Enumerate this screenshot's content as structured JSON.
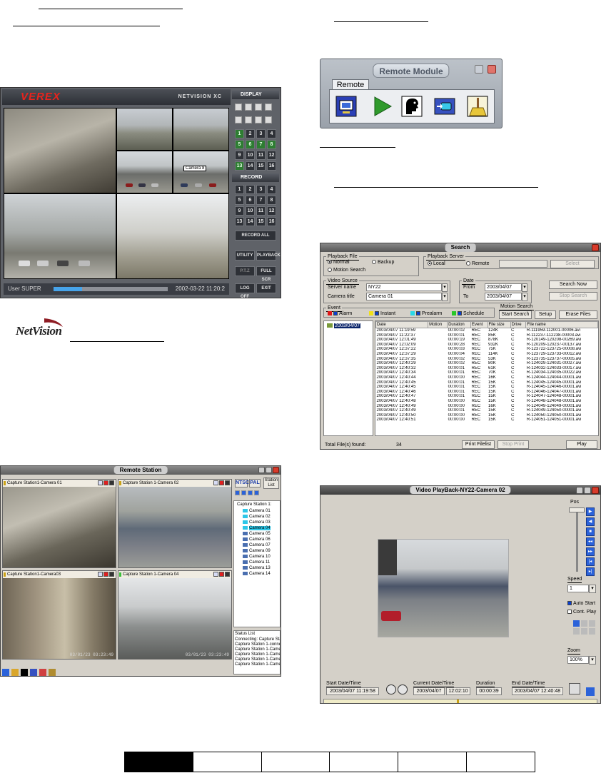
{
  "netvision_screen": {
    "brand": "VEREX",
    "product": "NETVISION XC",
    "camera_label": "Camera 8",
    "display_label": "DISPLAY",
    "record_label": "RECORD",
    "display_numbers": [
      "1",
      "2",
      "3",
      "4",
      "5",
      "6",
      "7",
      "8",
      "9",
      "10",
      "11",
      "12",
      "13",
      "14",
      "15",
      "16"
    ],
    "record_numbers": [
      "1",
      "2",
      "3",
      "4",
      "5",
      "6",
      "7",
      "8",
      "9",
      "10",
      "11",
      "12",
      "13",
      "14",
      "15",
      "16"
    ],
    "record_all": "RECORD ALL",
    "buttons": [
      "UTILITY",
      "PLAYBACK",
      "P.T.Z",
      "FULL SCR",
      "LOG OFF",
      "EXIT"
    ],
    "user": "User SUPER",
    "datetime": "2002-03-22 11:20:2",
    "progress_fraction": 0.25,
    "colors": {
      "brand_red": "#e8231d",
      "progress": "#47a4ea",
      "active_green": "#2e7d32"
    }
  },
  "netvision_logo": {
    "text": "NetVision"
  },
  "remote_module": {
    "title": "Remote Module",
    "tab": "Remote",
    "icons": [
      "monitor-icon",
      "play-icon",
      "face-profile-icon",
      "camera-transfer-icon",
      "broom-icon"
    ]
  },
  "search_window": {
    "title": "Search",
    "playback_file": {
      "label": "Playback File",
      "options": [
        "Normal",
        "Backup",
        "Motion Search"
      ]
    },
    "playback_server": {
      "label": "Playback Server",
      "options": [
        "Local",
        "Remote"
      ],
      "select_btn": "Select"
    },
    "video_source": {
      "label": "Video Source",
      "server_name_label": "Server name",
      "server_name": "NY22",
      "camera_title_label": "Camera title",
      "camera_title": "Camera 01"
    },
    "date": {
      "label": "Date",
      "from_label": "From",
      "from": "2003/04/07",
      "to_label": "To",
      "to": "2003/04/07"
    },
    "search_now": "Search Now",
    "stop_search": "Stop Search",
    "event": {
      "label": "Event",
      "items": [
        "Alarm",
        "Instant",
        "Prealarm",
        "Schedule"
      ],
      "colors": [
        "#e01818",
        "#f0e018",
        "#28d8e8",
        "#28c828"
      ]
    },
    "motion_search": {
      "label": "Motion Search",
      "start": "Start Search",
      "setup": "Setup",
      "erase": "Erase Files"
    },
    "tree_date": "2003/04/07",
    "columns": [
      "Date",
      "Motion",
      "Duration",
      "Event",
      "File size",
      "Drive",
      "File name"
    ],
    "rows": [
      [
        "2003/04/07 11:19:59",
        "",
        "00:00:02",
        "REC",
        "124K",
        "C",
        "R-111959-112001-00006.avi"
      ],
      [
        "2003/04/07 11:22:37",
        "",
        "00:00:01",
        "REC",
        "85K",
        "C",
        "R-112237-112238-00003.avi"
      ],
      [
        "2003/04/07 12:01:49",
        "",
        "00:00:19",
        "REC",
        "878K",
        "C",
        "R-120149-120208-00269.avi"
      ],
      [
        "2003/04/07 12:02:09",
        "",
        "00:00:28",
        "REC",
        "932K",
        "C",
        "R-120209-120237-00137.avi"
      ],
      [
        "2003/04/07 12:37:22",
        "",
        "00:00:03",
        "REC",
        "75K",
        "C",
        "R-123722-123725-00008.avi"
      ],
      [
        "2003/04/07 12:37:29",
        "",
        "00:00:04",
        "REC",
        "114K",
        "C",
        "R-123729-123733-00012.avi"
      ],
      [
        "2003/04/07 12:37:35",
        "",
        "00:00:02",
        "REC",
        "53K",
        "C",
        "R-123735-123737-00005.avi"
      ],
      [
        "2003/04/07 12:40:29",
        "",
        "00:00:02",
        "REC",
        "80K",
        "C",
        "R-124029-124031-00027.avi"
      ],
      [
        "2003/04/07 12:40:32",
        "",
        "00:00:01",
        "REC",
        "61K",
        "C",
        "R-124032-124033-00017.avi"
      ],
      [
        "2003/04/07 12:40:34",
        "",
        "00:00:01",
        "REC",
        "70K",
        "C",
        "R-124034-124035-00022.avi"
      ],
      [
        "2003/04/07 12:40:44",
        "",
        "00:00:00",
        "REC",
        "16K",
        "C",
        "R-124044-124044-00001.avi"
      ],
      [
        "2003/04/07 12:40:45",
        "",
        "00:00:01",
        "REC",
        "15K",
        "C",
        "R-124045-124045-00001.avi"
      ],
      [
        "2003/04/07 12:40:45",
        "",
        "00:00:01",
        "REC",
        "15K",
        "C",
        "R-124045-124046-00001.avi"
      ],
      [
        "2003/04/07 12:40:46",
        "",
        "00:00:01",
        "REC",
        "15K",
        "C",
        "R-124046-124047-00001.avi"
      ],
      [
        "2003/04/07 12:40:47",
        "",
        "00:00:01",
        "REC",
        "15K",
        "C",
        "R-124047-124048-00001.avi"
      ],
      [
        "2003/04/07 12:40:48",
        "",
        "00:00:00",
        "REC",
        "15K",
        "C",
        "R-124048-124048-00001.avi"
      ],
      [
        "2003/04/07 12:40:49",
        "",
        "00:00:00",
        "REC",
        "16K",
        "C",
        "R-124049-124049-00001.avi"
      ],
      [
        "2003/04/07 12:40:49",
        "",
        "00:00:01",
        "REC",
        "15K",
        "C",
        "R-124049-124050-00001.avi"
      ],
      [
        "2003/04/07 12:40:50",
        "",
        "00:00:00",
        "REC",
        "15K",
        "C",
        "R-124050-124050-00001.avi"
      ],
      [
        "2003/04/07 12:40:51",
        "",
        "00:00:00",
        "REC",
        "15K",
        "C",
        "R-124051-124051-00001.avi"
      ]
    ],
    "total_label": "Total File(s) found:",
    "total_count": "34",
    "print_filelist": "Print Filelist",
    "stop_print": "Stop Print",
    "play": "Play"
  },
  "remote_station": {
    "title": "Remote Station",
    "panes": [
      {
        "title": "Capture Station1-Camera 01",
        "time": ""
      },
      {
        "title": "Capture Station 1-Camera 02",
        "time": ""
      },
      {
        "title": "Capture Station1-Camera03",
        "time": "03/01/23 03:23:49"
      },
      {
        "title": "Capture Station 1-Camera 04",
        "time": "03/01/23 03:23:49"
      }
    ],
    "format_buttons": [
      "NTSC",
      "PAL"
    ],
    "station_list_label": "Station List",
    "tree_root": "Capture Station 1:",
    "cameras": [
      "Camera 01",
      "Camera 02",
      "Camera 03",
      "Camera 04",
      "Camera 05",
      "Camera 06",
      "Camera 07",
      "Camera 09",
      "Camera 10",
      "Camera 11",
      "Camera 13",
      "Camera 14"
    ],
    "status_label": "Status List",
    "status_lines": [
      "Connecting: Capture Station",
      "Capture Station 1-connecti",
      "Capture Station 1-Camera 0",
      "Capture Station 1-Camera 0",
      "Capture Station 1-Camera 0",
      "Capture Station 1-Camera 0"
    ]
  },
  "playback_window": {
    "title": "Video PlayBack-NY22-Camera 02",
    "pos_label": "Pos",
    "speed_label": "Speed",
    "speed_value": "1",
    "auto_start": "Auto Start",
    "cont_play": "Cont. Play",
    "zoom_label": "Zoom",
    "zoom_value": "100%",
    "start_label": "Start Date/Time",
    "start_value": "2003/04/07 11:19:58",
    "current_label": "Current Date/Time",
    "current_date": "2003/04/07",
    "current_time": "12:02:10",
    "duration_label": "Duration",
    "duration_value": "00:00:39",
    "end_label": "End Date/Time",
    "end_value": "2003/04/07 12:40:48"
  }
}
